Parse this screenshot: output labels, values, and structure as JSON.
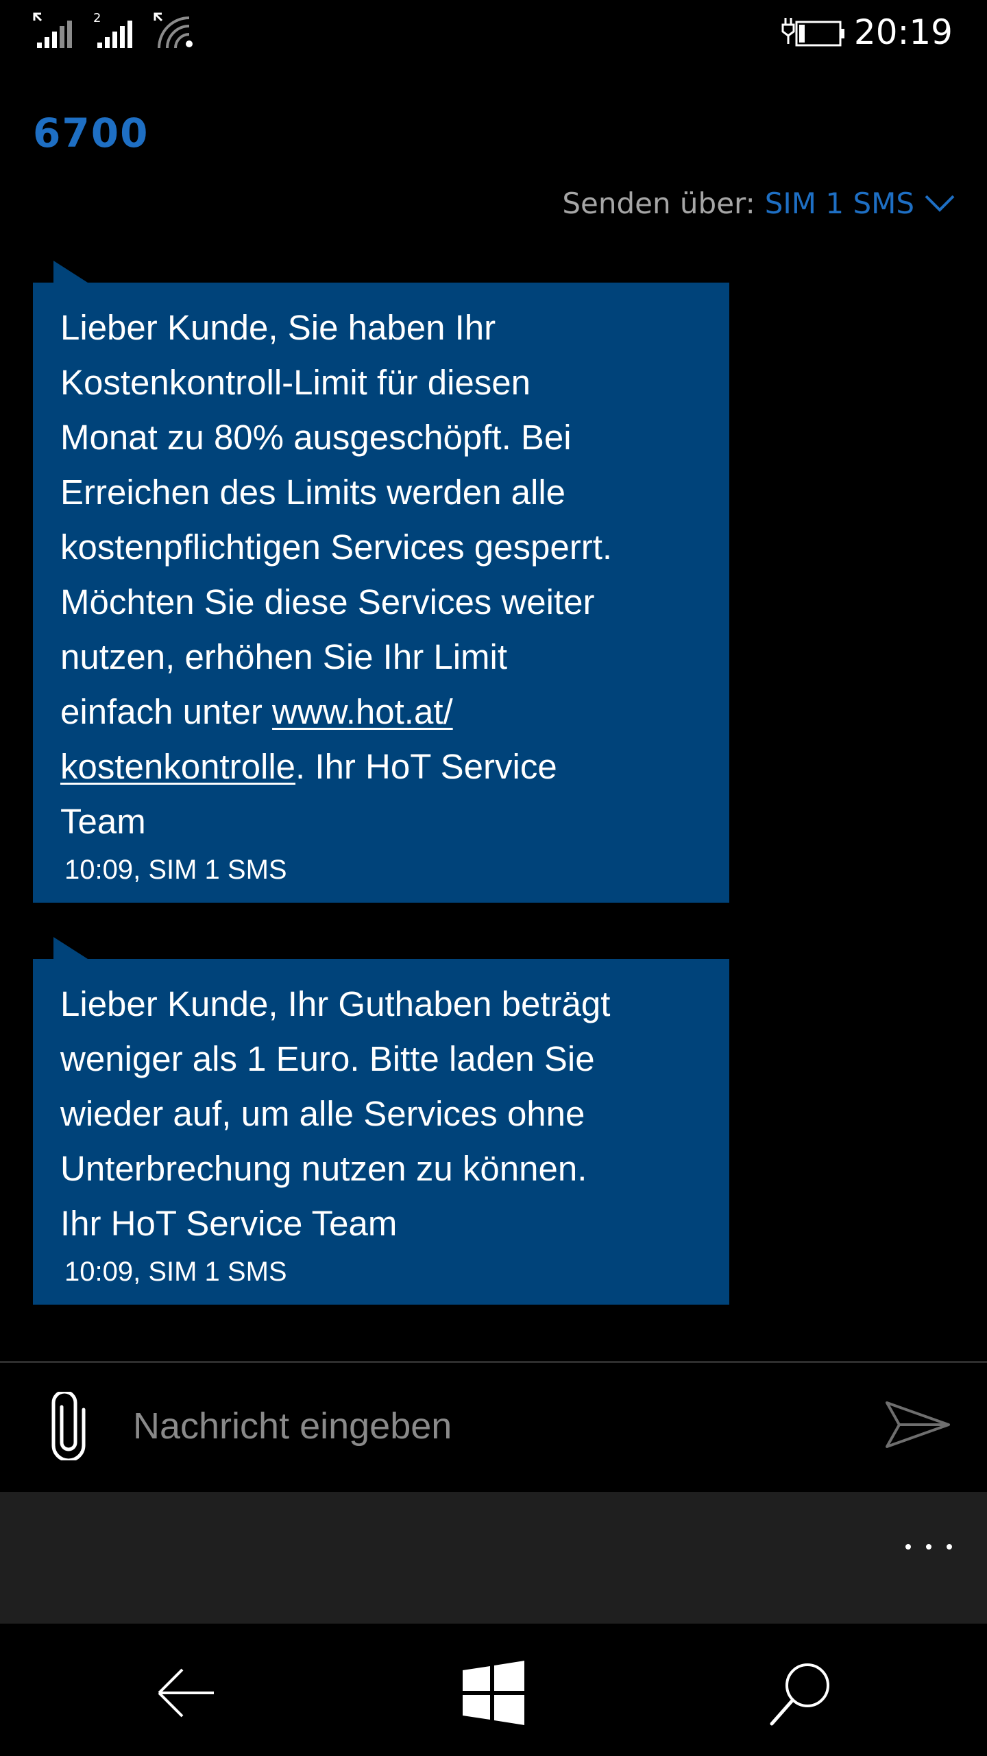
{
  "status_bar": {
    "time": "20:19",
    "sim2_number": "2",
    "icons": [
      "signal-sim1-icon",
      "signal-sim2-icon",
      "wifi-icon",
      "battery-charging-icon"
    ]
  },
  "header": {
    "title": "6700",
    "send_via_label": "Senden über:",
    "send_via_value": "SIM 1 SMS"
  },
  "messages": [
    {
      "text_before_link": "Lieber Kunde, Sie haben Ihr\nKostenkontroll-Limit für diesen\nMonat zu 80% ausgeschöpft. Bei\nErreichen des Limits werden alle\nkostenpflichtigen Services gesperrt.\nMöchten Sie diese Services weiter\nnutzen, erhöhen Sie Ihr Limit\neinfach unter ",
      "link": "www.hot.at/\nkostenkontrolle",
      "text_after_link": ". Ihr HoT Service\nTeam",
      "meta": "10:09, SIM 1 SMS"
    },
    {
      "text": "Lieber Kunde, Ihr Guthaben beträgt\nweniger als 1 Euro. Bitte laden Sie\nwieder auf, um alle Services ohne\nUnterbrechung nutzen zu können.\nIhr HoT Service Team",
      "meta": "10:09, SIM 1 SMS"
    }
  ],
  "composer": {
    "placeholder": "Nachricht eingeben",
    "value": ""
  },
  "app_bar": {
    "more_label": "..."
  },
  "nav_bar": {
    "icons": [
      "back-arrow-icon",
      "windows-start-icon",
      "search-icon"
    ]
  },
  "colors": {
    "accent": "#1e6fc4",
    "bubble": "#00437a",
    "app_bar": "#1f1f1f",
    "background": "#000000"
  }
}
